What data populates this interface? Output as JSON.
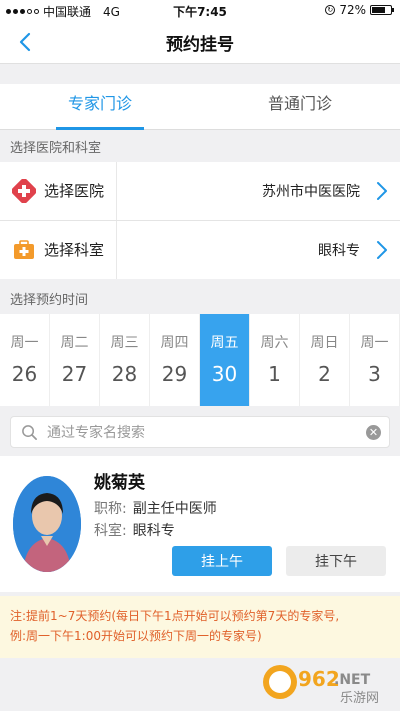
{
  "status_bar": {
    "carrier": "中国联通",
    "network": "4G",
    "time": "下午7:45",
    "battery": "72%",
    "battery_level": 0.72
  },
  "nav": {
    "title": "预约挂号",
    "back_icon": "chevron-left-icon"
  },
  "tabs": [
    {
      "label": "专家门诊",
      "active": true
    },
    {
      "label": "普通门诊",
      "active": false
    }
  ],
  "section_hospital": "选择医院和科室",
  "hospital_row": {
    "label": "选择医院",
    "value": "苏州市中医医院",
    "icon": "hospital-cross-icon"
  },
  "department_row": {
    "label": "选择科室",
    "value": "眼科专",
    "icon": "medical-kit-icon"
  },
  "section_time": "选择预约时间",
  "days": [
    {
      "weekday": "周一",
      "date": "26",
      "active": false
    },
    {
      "weekday": "周二",
      "date": "27",
      "active": false
    },
    {
      "weekday": "周三",
      "date": "28",
      "active": false
    },
    {
      "weekday": "周四",
      "date": "29",
      "active": false
    },
    {
      "weekday": "周五",
      "date": "30",
      "active": true
    },
    {
      "weekday": "周六",
      "date": "1",
      "active": false
    },
    {
      "weekday": "周日",
      "date": "2",
      "active": false
    },
    {
      "weekday": "周一",
      "date": "3",
      "active": false
    }
  ],
  "search": {
    "placeholder": "通过专家名搜索"
  },
  "doctor": {
    "name": "姚菊英",
    "title_label": "职称:",
    "title_value": "副主任中医师",
    "dept_label": "科室:",
    "dept_value": "眼科专",
    "btn_am": "挂上午",
    "btn_pm": "挂下午"
  },
  "note": {
    "line1": "注:提前1~7天预约(每日下午1点开始可以预约第7天的专家号,",
    "line2": "例:周一下午1:00开始可以预约下周一的专家号)"
  },
  "watermark": {
    "brand": "962",
    "suffix": ".NET",
    "sub": "乐游网"
  },
  "colors": {
    "accent": "#1f96e6",
    "active_day": "#37a3ee",
    "note_text": "#e0602a",
    "hospital_icon": "#e0424c",
    "dept_icon": "#f39a2b"
  }
}
